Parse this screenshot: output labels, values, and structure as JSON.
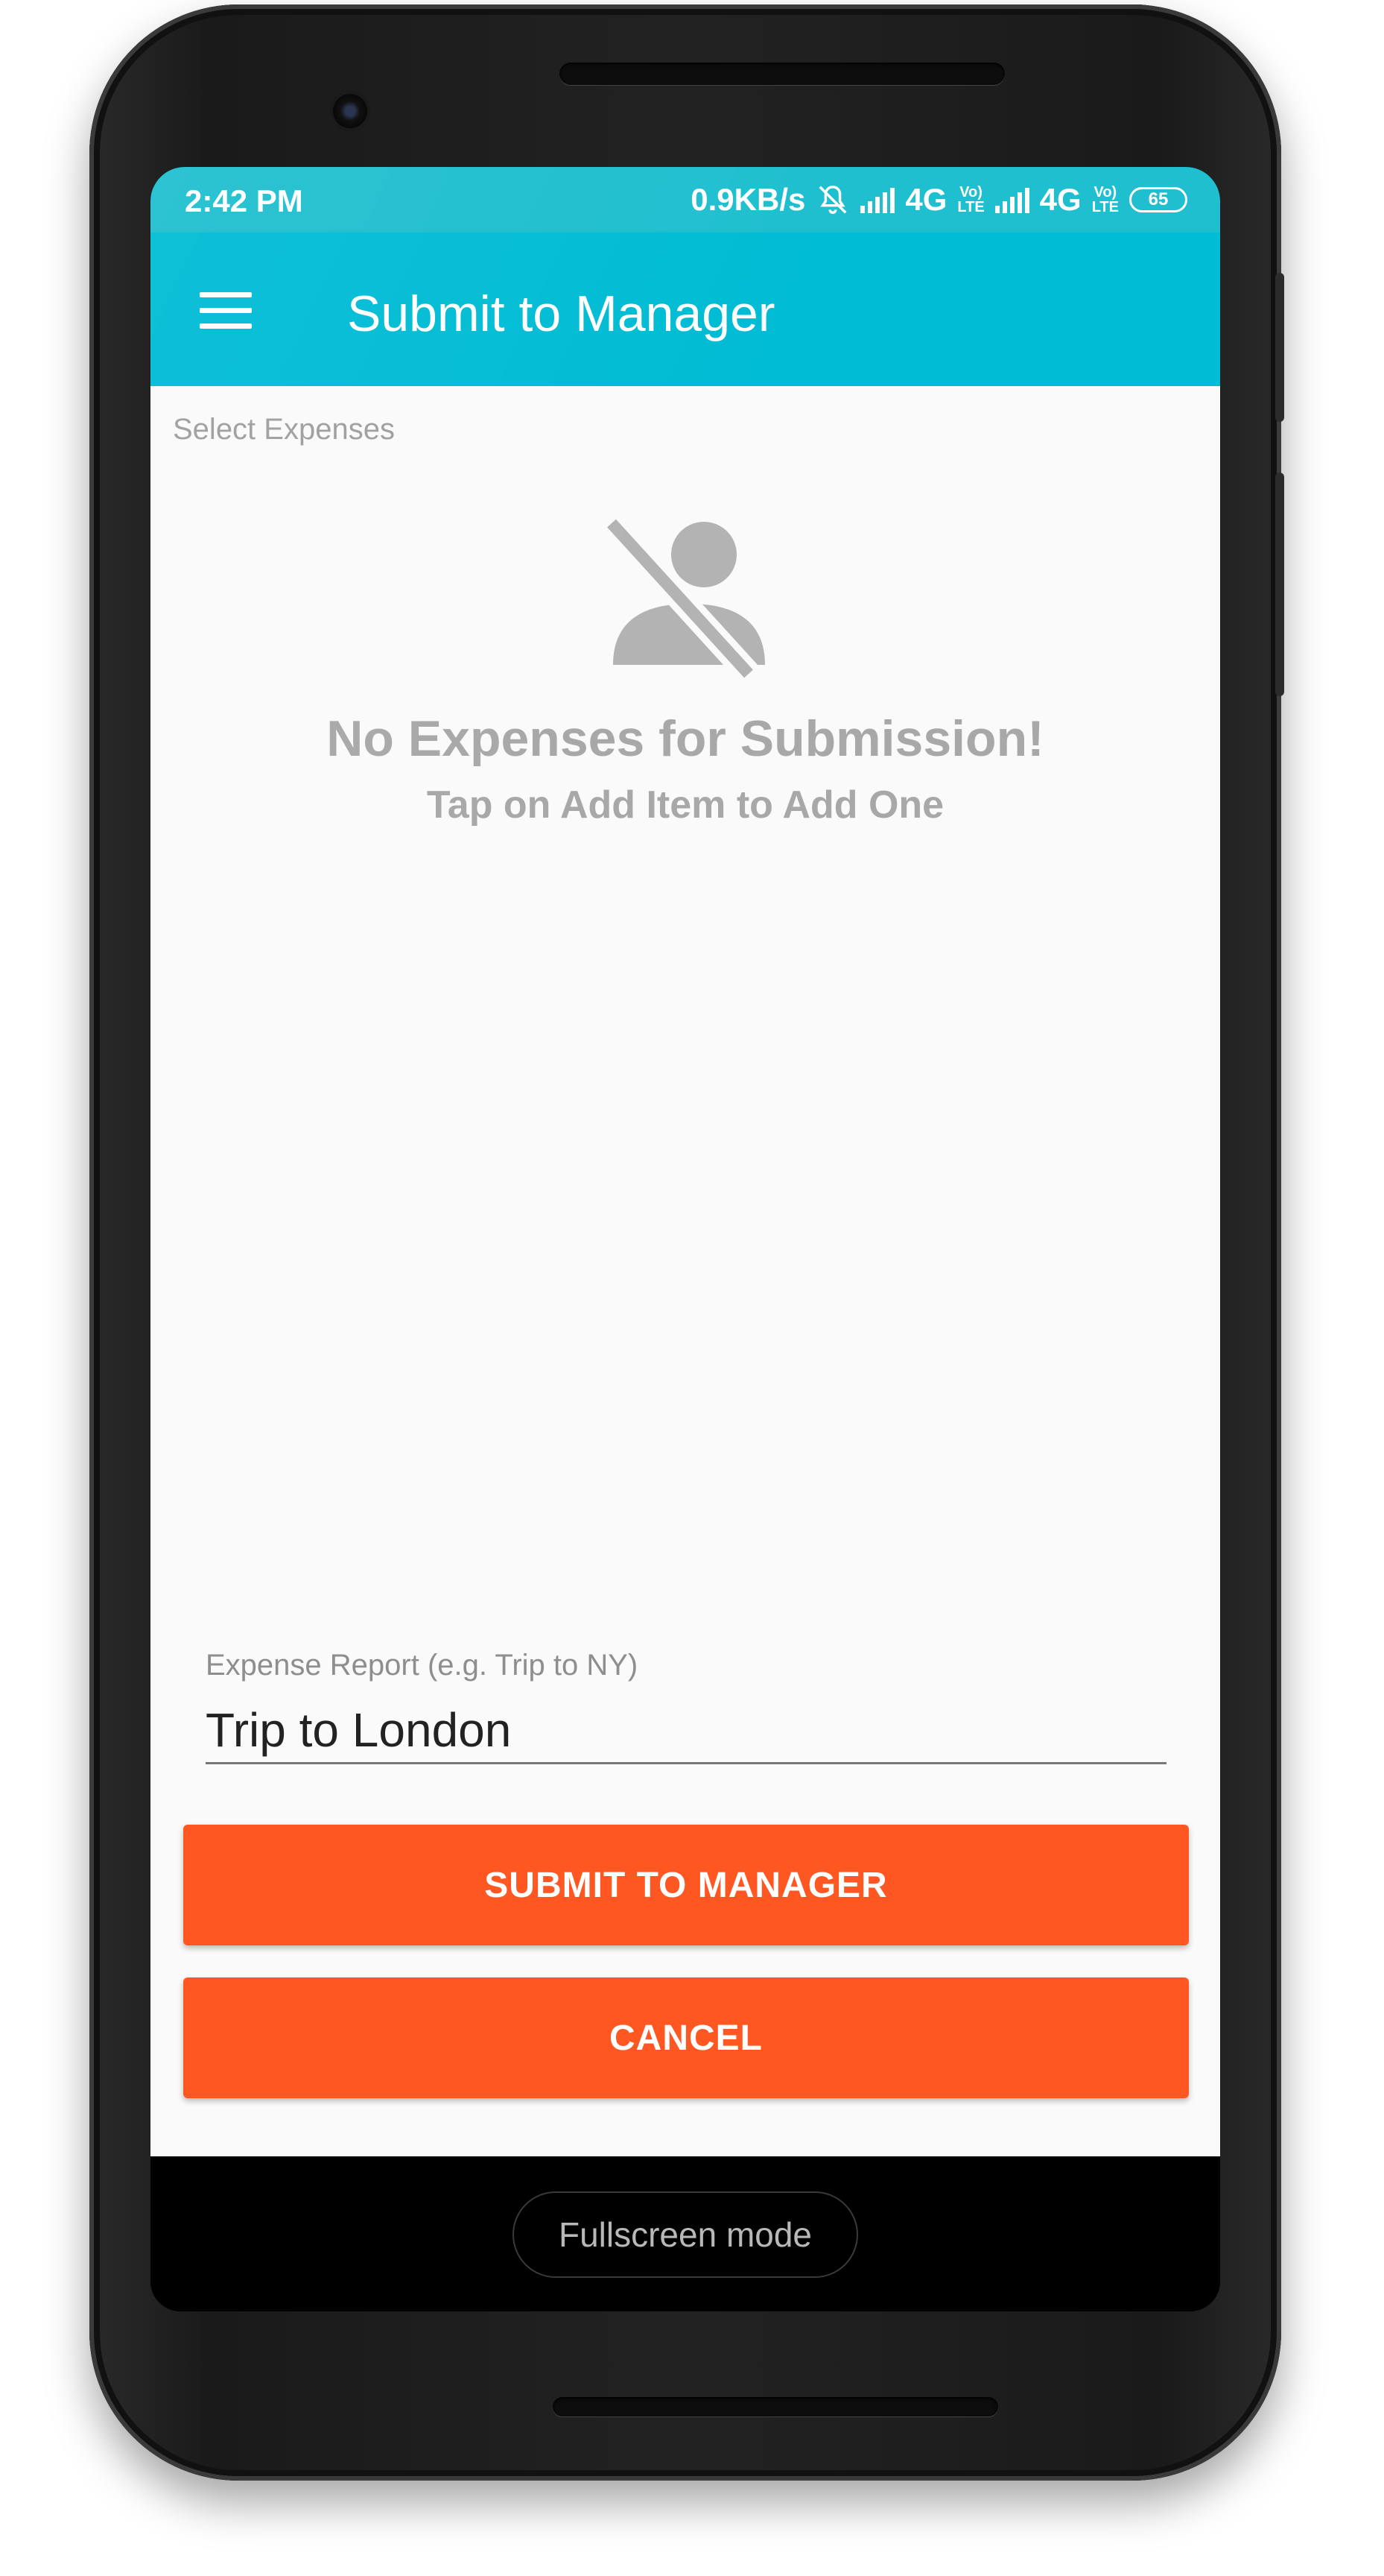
{
  "statusbar": {
    "time": "2:42 PM",
    "speed": "0.9KB/s",
    "network1": "4G",
    "volte1_top": "Vo)",
    "volte1_bottom": "LTE",
    "network2": "4G",
    "volte2_top": "Vo)",
    "volte2_bottom": "LTE",
    "battery": "65",
    "icons": [
      "mute-bell-icon",
      "signal-icon",
      "signal-icon",
      "battery-icon"
    ]
  },
  "toolbar": {
    "title": "Submit to Manager",
    "menu_icon": "hamburger-menu-icon",
    "color": "#00bcd4"
  },
  "content": {
    "select_label": "Select Expenses",
    "empty_icon": "person-off-icon",
    "empty_title": "No Expenses for Submission!",
    "empty_subtitle": "Tap on Add Item to Add One"
  },
  "form": {
    "report_label": "Expense Report (e.g. Trip to NY)",
    "report_value": "Trip to London"
  },
  "actions": {
    "submit_label": "SUBMIT TO MANAGER",
    "cancel_label": "CANCEL",
    "button_color": "#ff5722"
  },
  "overlay": {
    "fullscreen_label": "Fullscreen mode"
  }
}
